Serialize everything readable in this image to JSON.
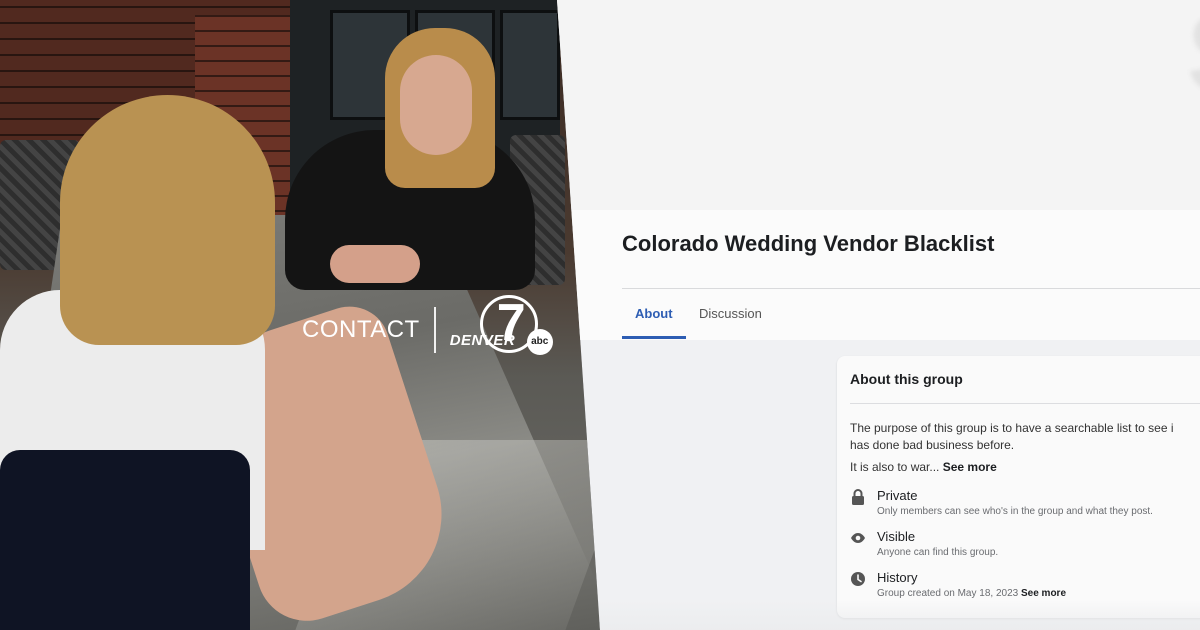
{
  "overlay": {
    "contact_label": "CONTACT",
    "station_word": "DENVER",
    "station_number": "7",
    "network_badge": "abc"
  },
  "facebook_group": {
    "title": "Colorado Wedding Vendor Blacklist",
    "tabs": [
      {
        "label": "About",
        "active": true
      },
      {
        "label": "Discussion",
        "active": false
      }
    ],
    "about_card": {
      "heading": "About this group",
      "description": "The purpose of this group is to have a searchable list to see i\nhas done bad business before.",
      "more_text": "It is also to war...",
      "more_link": "See more",
      "rows": [
        {
          "icon": "lock-icon",
          "title": "Private",
          "subtitle": "Only members can see who's in the group and what they post."
        },
        {
          "icon": "eye-icon",
          "title": "Visible",
          "subtitle": "Anyone can find this group."
        },
        {
          "icon": "clock-icon",
          "title": "History",
          "subtitle": "Group created on May 18, 2023",
          "subtitle_link": "See more"
        }
      ]
    }
  },
  "colors": {
    "accent_blue": "#2d5db3",
    "flag_red": "#e00000"
  }
}
